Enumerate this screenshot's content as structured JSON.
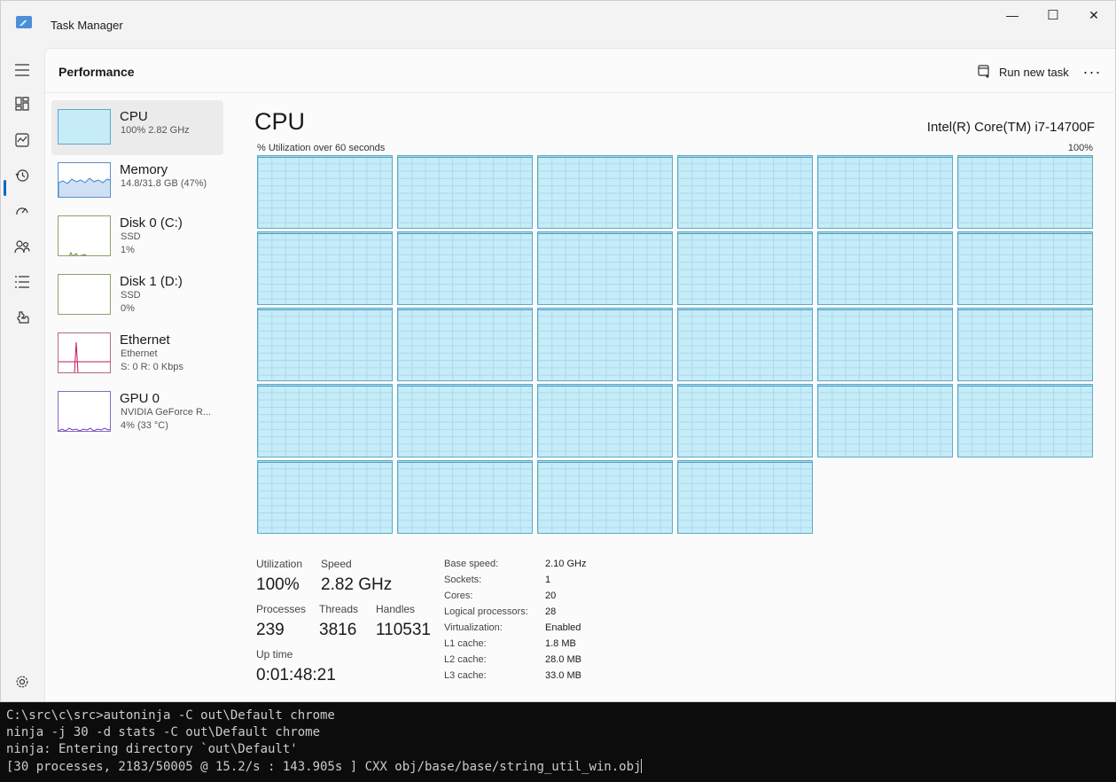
{
  "window": {
    "title": "Task Manager",
    "controls": {
      "minimize": "—",
      "maximize": "☐",
      "close": "✕"
    }
  },
  "nav_rail": [
    "menu-icon",
    "processes-icon",
    "performance-icon",
    "app-history-icon",
    "startup-apps-icon",
    "users-icon",
    "details-icon",
    "services-icon",
    "settings-icon"
  ],
  "header": {
    "page_title": "Performance",
    "run_task_label": "Run new task",
    "more_label": "···"
  },
  "resources": [
    {
      "name": "CPU",
      "line1": "100%  2.82 GHz",
      "line2": ""
    },
    {
      "name": "Memory",
      "line1": "14.8/31.8 GB (47%)",
      "line2": ""
    },
    {
      "name": "Disk 0 (C:)",
      "line1": "SSD",
      "line2": "1%"
    },
    {
      "name": "Disk 1 (D:)",
      "line1": "SSD",
      "line2": "0%"
    },
    {
      "name": "Ethernet",
      "line1": "Ethernet",
      "line2": "S: 0  R: 0 Kbps"
    },
    {
      "name": "GPU 0",
      "line1": "NVIDIA GeForce R...",
      "line2": "4%  (33 °C)"
    }
  ],
  "cpu": {
    "heading": "CPU",
    "model": "Intel(R) Core(TM) i7-14700F",
    "graph_label": "% Utilization over 60 seconds",
    "graph_max": "100%",
    "logical_processor_graphs": 28,
    "stats": {
      "utilization_label": "Utilization",
      "utilization": "100%",
      "speed_label": "Speed",
      "speed": "2.82 GHz",
      "processes_label": "Processes",
      "processes": "239",
      "threads_label": "Threads",
      "threads": "3816",
      "handles_label": "Handles",
      "handles": "110531",
      "uptime_label": "Up time",
      "uptime": "0:01:48:21"
    },
    "specs": [
      {
        "label": "Base speed:",
        "value": "2.10 GHz"
      },
      {
        "label": "Sockets:",
        "value": "1"
      },
      {
        "label": "Cores:",
        "value": "20"
      },
      {
        "label": "Logical processors:",
        "value": "28"
      },
      {
        "label": "Virtualization:",
        "value": "Enabled"
      },
      {
        "label": "L1 cache:",
        "value": "1.8 MB"
      },
      {
        "label": "L2 cache:",
        "value": "28.0 MB"
      },
      {
        "label": "L3 cache:",
        "value": "33.0 MB"
      }
    ]
  },
  "terminal": {
    "lines": [
      "C:\\src\\c\\src>autoninja -C out\\Default chrome",
      "ninja -j 30 -d stats -C out\\Default chrome",
      "ninja: Entering directory `out\\Default'",
      "[30 processes, 2183/50005 @ 15.2/s : 143.905s ] CXX obj/base/base/string_util_win.obj"
    ]
  },
  "colors": {
    "cpu_fill": "#c6ecf8",
    "cpu_border": "#5ea9c9",
    "accent": "#0067c0",
    "memory_line": "#3d7fc4",
    "ethernet_line": "#c2185b",
    "gpu_line": "#6a3fb5",
    "terminal_bg": "#0c0c0c"
  }
}
